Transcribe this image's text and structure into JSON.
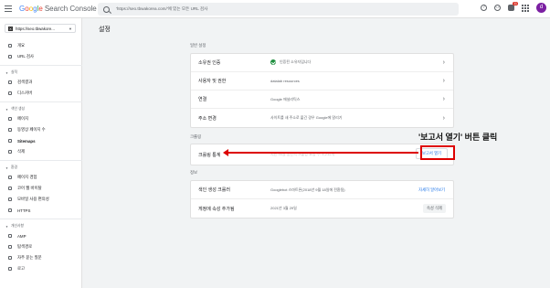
{
  "header": {
    "logo_google": [
      "G",
      "o",
      "o",
      "g",
      "l",
      "e"
    ],
    "logo_product": "Search Console",
    "search_placeholder": "'https://seo.tbwakorea.com/'에 있는 모든 URL 검사",
    "help_icon": "help-icon",
    "notifications_count": "11",
    "avatar_letter": "d"
  },
  "sidebar": {
    "property": "https://seo.tbwakore...",
    "items_top": [
      {
        "label": "개요",
        "icon": "home-icon"
      },
      {
        "label": "URL 검사",
        "icon": "search-icon"
      }
    ],
    "section_performance": "실적",
    "items_performance": [
      {
        "label": "검색결과",
        "icon": "google-icon"
      },
      {
        "label": "디스커버",
        "icon": "discover-icon"
      }
    ],
    "section_index": "색인 생성",
    "items_index": [
      {
        "label": "페이지",
        "icon": "pages-icon"
      },
      {
        "label": "동영상 페이지 수",
        "icon": "video-icon"
      },
      {
        "label": "Sitemaps",
        "icon": "sitemap-icon"
      },
      {
        "label": "삭제",
        "icon": "removal-icon"
      }
    ],
    "section_experience": "환경",
    "items_experience": [
      {
        "label": "페이지 경험",
        "icon": "experience-icon"
      },
      {
        "label": "코어 웹 바이탈",
        "icon": "vitals-icon"
      },
      {
        "label": "모바일 사용 편의성",
        "icon": "mobile-icon"
      },
      {
        "label": "HTTPS",
        "icon": "lock-icon"
      }
    ],
    "section_enhancements": "개선사항",
    "items_enhancements": [
      {
        "label": "AMP",
        "icon": "amp-icon"
      },
      {
        "label": "탐색경로",
        "icon": "breadcrumb-icon"
      },
      {
        "label": "자주 묻는 질문",
        "icon": "faq-icon"
      },
      {
        "label": "로고",
        "icon": "logo-icon"
      }
    ]
  },
  "main": {
    "title": "설정",
    "general_label": "일반 설정",
    "general_rows": [
      {
        "label": "소유권 인증",
        "value": "인증된 소유자입니다",
        "verified": true
      },
      {
        "label": "사용자 및 권한",
        "value": "datalab resources"
      },
      {
        "label": "연결",
        "value": "Google 애널리틱스"
      },
      {
        "label": "주소 변경",
        "value": "사이트를 새 주소로 옮긴 경우 Google에 알리기"
      }
    ],
    "crawl_label": "크롤링",
    "crawl_row": {
      "label": "크롤링 통계",
      "value": "지난 90일 동안의 크롤링 요청 수: 4,211개",
      "button": "보고서 열기"
    },
    "about_label": "정보",
    "about_rows": [
      {
        "label": "색인 생성 크롤러",
        "value": "Googlebot 스마트폰(2018년 9월 18일에 전환됨)",
        "action": "자세히 알아보기"
      },
      {
        "label": "게정에 속성 추가됨",
        "value": "2021년 3월 29일",
        "action": "속성 삭제"
      }
    ]
  },
  "annotation": {
    "text": "'보고서 열기' 버튼 클릭",
    "color": "#dd0000"
  }
}
